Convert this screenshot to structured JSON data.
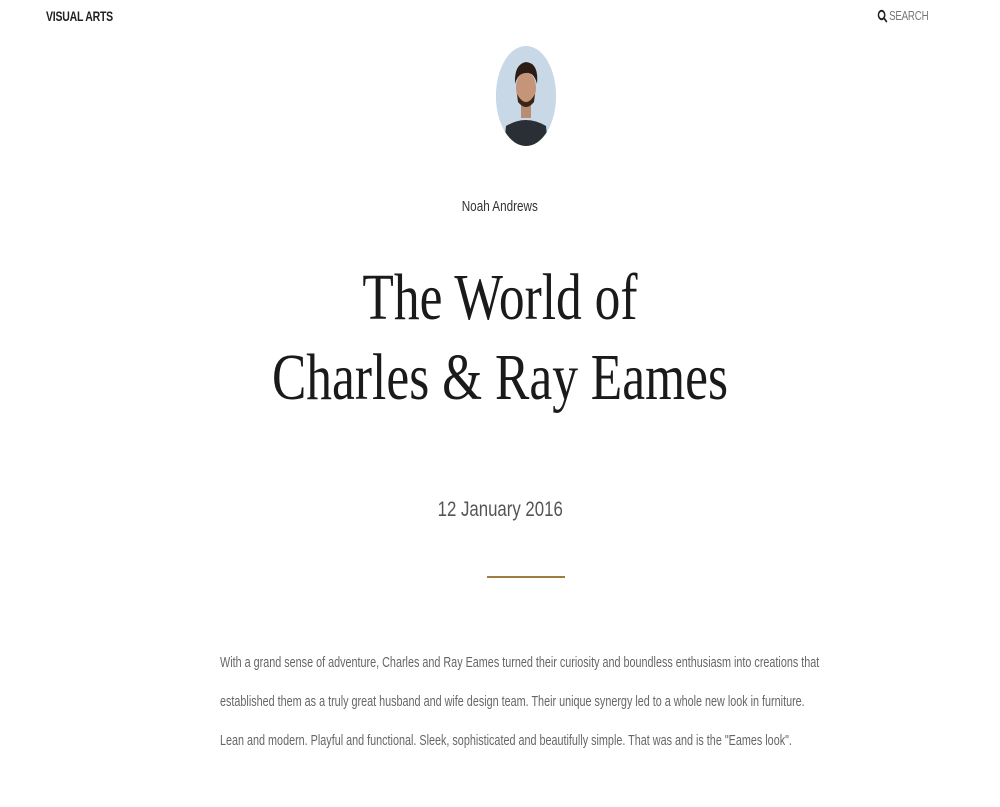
{
  "header": {
    "brand": "VISUAL ARTS",
    "search_label": "SEARCH",
    "search_icon": "search-icon"
  },
  "article": {
    "author": "Noah Andrews",
    "title_line1": "The World of",
    "title_line2": "Charles & Ray Eames",
    "date": "12 January 2016",
    "accent_color": "#a07c43",
    "body": "With a grand sense of adventure, Charles and Ray Eames turned their curiosity and boundless enthusiasm into creations that established them as a truly great husband and wife design team. Their unique synergy led to a whole new look in furniture. Lean and modern. Playful and functional. Sleek, sophisticated and beautifully simple. That was and is the \"Eames look\"."
  }
}
